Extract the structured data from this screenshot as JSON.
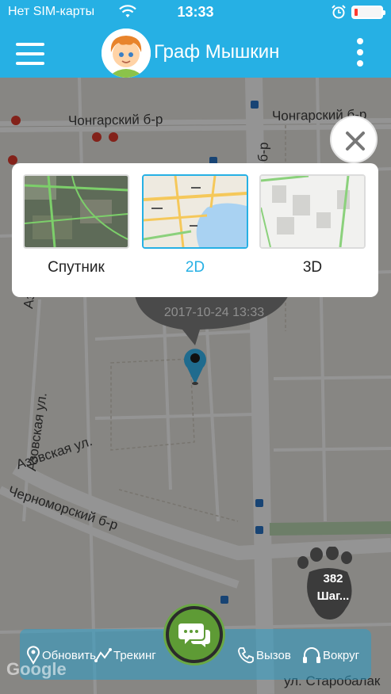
{
  "status_bar": {
    "carrier": "Нет SIM-карты",
    "time": "13:33"
  },
  "nav": {
    "title": "Граф Мышкин"
  },
  "map": {
    "street_labels": [
      "Чонгарский б-р",
      "Чонгарский б-р",
      "Азовская ул.",
      "Азовская ул.",
      "Азовская ул.",
      "Черноморский б-р",
      "ул. Старобалак",
      "б-р"
    ],
    "bubble_timestamp": "2017-10-24 13:33",
    "attribution": "Google"
  },
  "map_type": {
    "options": [
      {
        "label": "Спутник",
        "selected": false
      },
      {
        "label": "2D",
        "selected": true
      },
      {
        "label": "3D",
        "selected": false
      }
    ]
  },
  "steps": {
    "count": "382",
    "unit": "Шаг..."
  },
  "toolbar": {
    "refresh": "Обновить",
    "tracking": "Трекинг",
    "call": "Вызов",
    "around": "Вокруг"
  },
  "colors": {
    "accent": "#26b0e4",
    "chat_green": "#5e9b35",
    "map_dim": "rgba(0,0,0,0.42)"
  },
  "icons": [
    "menu-icon",
    "avatar",
    "more-icon",
    "wifi-icon",
    "alarm-icon",
    "battery-icon",
    "close-icon",
    "pin-icon",
    "footprint-icon",
    "chat-icon",
    "location-icon",
    "tracking-icon",
    "phone-icon",
    "headphones-icon"
  ]
}
